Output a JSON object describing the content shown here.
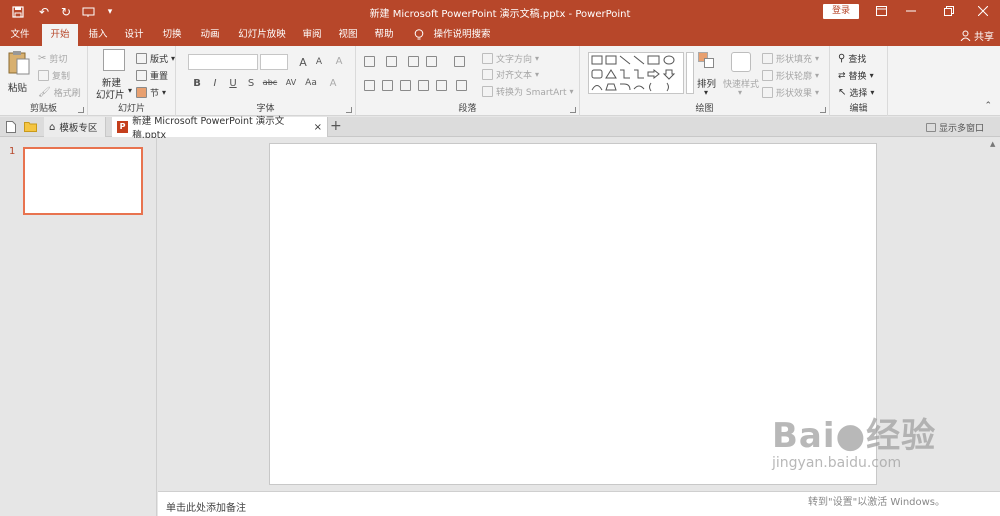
{
  "titlebar": {
    "title": "新建 Microsoft PowerPoint 演示文稿.pptx  -  PowerPoint",
    "login": "登录",
    "save_icon": "🖫",
    "undo_icon": "↶",
    "redo_icon": "↻",
    "customize_icon": "▾"
  },
  "tabs": {
    "file": "文件",
    "home": "开始",
    "insert": "插入",
    "design": "设计",
    "transitions": "切换",
    "animations": "动画",
    "slideshow": "幻灯片放映",
    "review": "审阅",
    "view": "视图",
    "help": "帮助",
    "tellme": "操作说明搜索",
    "share": "共享"
  },
  "ribbon": {
    "clipboard": {
      "label": "剪贴板",
      "paste": "粘贴",
      "cut": "剪切",
      "copy": "复制",
      "format_painter": "格式刷"
    },
    "slides": {
      "label": "幻灯片",
      "new_slide_line1": "新建",
      "new_slide_line2": "幻灯片",
      "layout": "版式",
      "reset": "重置",
      "section": "节"
    },
    "font": {
      "label": "字体",
      "bold": "B",
      "italic": "I",
      "underline": "U",
      "strike": "S",
      "shadow": "abc",
      "spacing": "AV",
      "case": "Aa",
      "clear": "A",
      "grow": "A",
      "shrink": "A"
    },
    "paragraph": {
      "label": "段落",
      "text_direction": "文字方向",
      "align_text": "对齐文本",
      "smartart": "转换为 SmartArt"
    },
    "drawing": {
      "label": "绘图",
      "arrange": "排列",
      "quick_styles": "快速样式",
      "shape_fill": "形状填充",
      "shape_outline": "形状轮廓",
      "shape_effects": "形状效果"
    },
    "editing": {
      "label": "编辑",
      "find": "查找",
      "replace": "替换",
      "select": "选择"
    }
  },
  "docstrip": {
    "template_zone": "模板专区",
    "doc_title": "新建 Microsoft PowerPoint 演示文稿.pptx",
    "show_multi": "显示多窗口"
  },
  "slides_panel": {
    "slide_number": "1"
  },
  "notes": {
    "placeholder": "单击此处添加备注"
  },
  "overlay": {
    "watermark_main": "Bai●经验",
    "watermark_sub": "jingyan.baidu.com",
    "activate_windows": "转到\"设置\"以激活 Windows。"
  }
}
